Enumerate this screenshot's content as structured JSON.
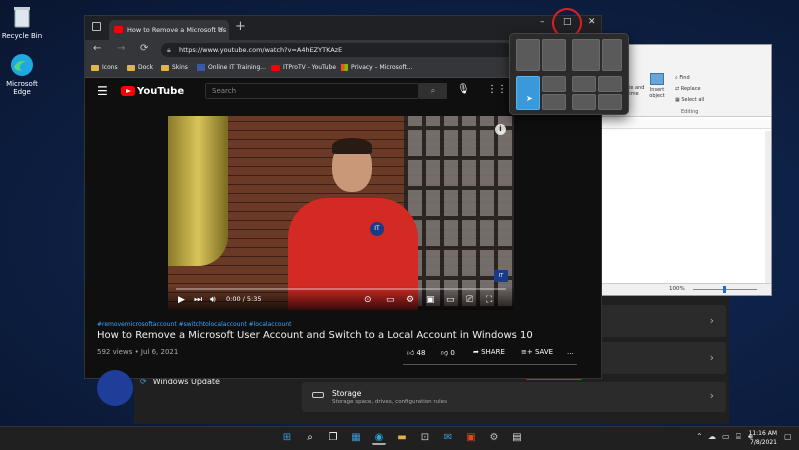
{
  "desktop": {
    "icons": [
      {
        "label": "Recycle Bin"
      },
      {
        "label": "Microsoft Edge"
      }
    ]
  },
  "browser": {
    "tab_title": "How to Remove a Microsoft Us",
    "tab_close": "✕",
    "new_tab": "+",
    "url": "https://www.youtube.com/watch?v=A4hEZYTKAzE",
    "bookmarks": [
      "Icons",
      "Dock",
      "Skins",
      "Online IT Training...",
      "ITProTV - YouTube",
      "Privacy – Microsoft..."
    ],
    "window_controls": {
      "minimize": "–",
      "maximize": "□",
      "close": "✕"
    }
  },
  "youtube": {
    "logo": "YouTube",
    "search_placeholder": "Search",
    "video": {
      "current_time": "0:00 / 5:35",
      "hashtags": "#removemicrosoftaccount #switchtolocalaccount #localaccount",
      "title": "How to Remove a Microsoft User Account and Switch to a Local Account in Windows 10",
      "views": "592 views • Jul 6, 2021",
      "likes": "48",
      "dislikes": "0",
      "share": "SHARE",
      "save": "SAVE",
      "more": "..."
    }
  },
  "settings": {
    "windows_update": "Windows Update",
    "storage_title": "Storage",
    "storage_desc": "Storage space, drives, configuration rules"
  },
  "wordpad": {
    "ribbon": [
      "Find",
      "Replace",
      "Select all"
    ],
    "group_label": "Editing",
    "insert_object": "Insert object",
    "paint_drawing": "Paint drawing",
    "date_time": "Date and time",
    "zoom": "100%"
  },
  "taskbar": {
    "time": "11:16 AM",
    "date": "7/8/2021"
  },
  "colors": {
    "accent": "#3a9ad9",
    "youtube_red": "#ff0000",
    "highlight_ring": "#e02020"
  }
}
